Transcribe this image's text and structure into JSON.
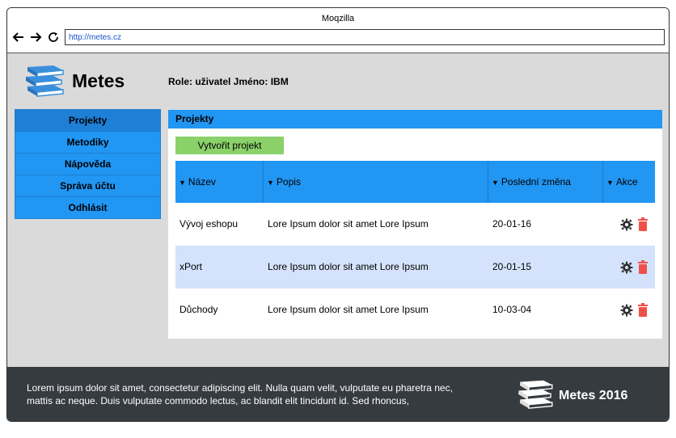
{
  "browser": {
    "title": "Moqzilla",
    "url": "http://metes.cz"
  },
  "header": {
    "app_name": "Metes",
    "user_info": "Role: uživatel Jméno: IBM"
  },
  "sidebar": {
    "items": [
      {
        "label": "Projekty"
      },
      {
        "label": "Metodiky"
      },
      {
        "label": "Nápověda"
      },
      {
        "label": "Správa účtu"
      },
      {
        "label": "Odhlásit"
      }
    ]
  },
  "main": {
    "panel_title": "Projekty",
    "create_button": "Vytvořit projekt",
    "columns": [
      {
        "label": "Název"
      },
      {
        "label": "Popis"
      },
      {
        "label": "Poslední změna"
      },
      {
        "label": "Akce"
      }
    ],
    "rows": [
      {
        "name": "Vývoj eshopu",
        "desc": "Lore Ipsum dolor sit amet Lore Ipsum",
        "date": "20-01-16"
      },
      {
        "name": "xPort",
        "desc": "Lore Ipsum dolor sit amet Lore Ipsum",
        "date": "20-01-15"
      },
      {
        "name": "Důchody",
        "desc": "Lore Ipsum dolor sit amet Lore Ipsum",
        "date": "10-03-04"
      }
    ]
  },
  "footer": {
    "text": "Lorem ipsum dolor sit amet, consectetur adipiscing elit. Nulla quam velit, vulputate eu pharetra nec, mattis ac neque. Duis vulputate commodo lectus, ac blandit elit tincidunt id. Sed rhoncus,",
    "brand": "Metes 2016"
  },
  "colors": {
    "accent": "#2196f3",
    "button_green": "#8bd16a",
    "trash": "#f0504a",
    "footer_bg": "#363b40"
  }
}
